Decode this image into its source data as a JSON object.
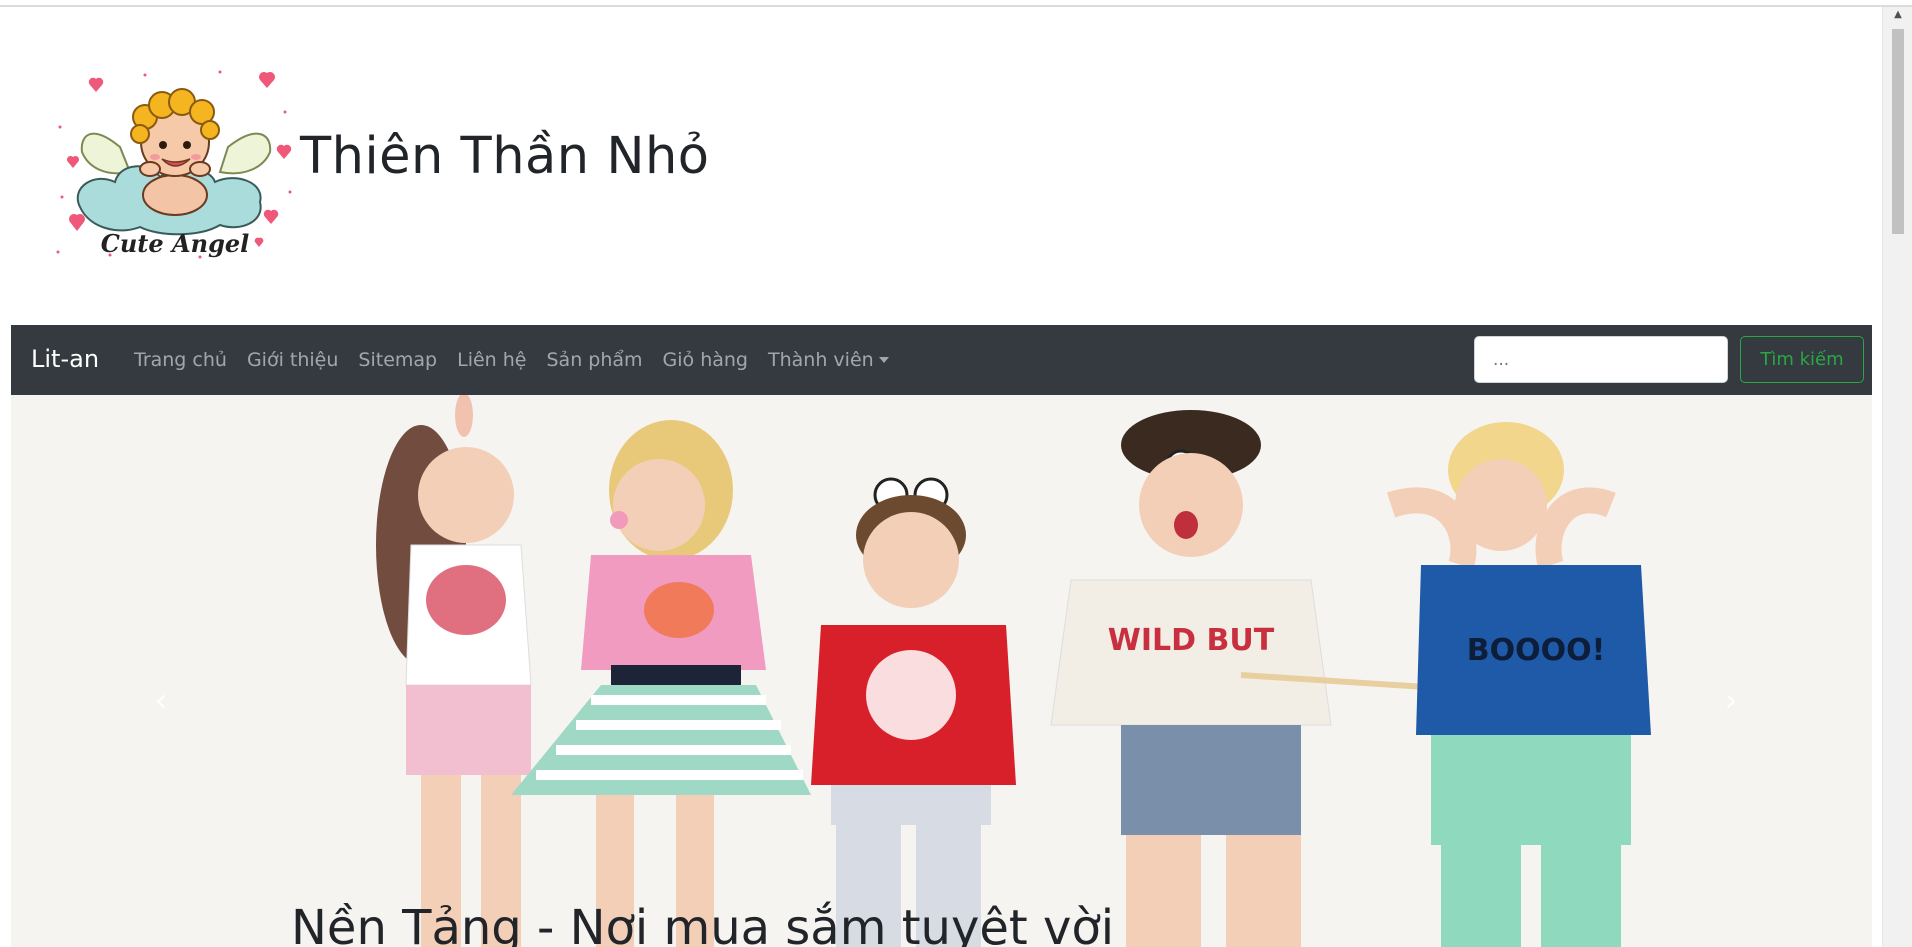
{
  "header": {
    "title": "Thiên Thần Nhỏ",
    "logo_text": "Cute Angel"
  },
  "navbar": {
    "brand": "Lit-an",
    "links": [
      {
        "label": "Trang chủ"
      },
      {
        "label": "Giới thiệu"
      },
      {
        "label": "Sitemap"
      },
      {
        "label": "Liên hệ"
      },
      {
        "label": "Sản phẩm"
      },
      {
        "label": "Giỏ hàng"
      },
      {
        "label": "Thành viên",
        "dropdown": true
      }
    ],
    "search": {
      "placeholder": "...",
      "button_label": "Tìm kiếm"
    }
  },
  "carousel": {
    "caption": "Nền Tảng - Nơi mua sắm tuyệt vời",
    "prev_icon": "chevron-left-icon",
    "next_icon": "chevron-right-icon"
  },
  "colors": {
    "navbar_bg": "#343a40",
    "search_button": "#28a745"
  }
}
